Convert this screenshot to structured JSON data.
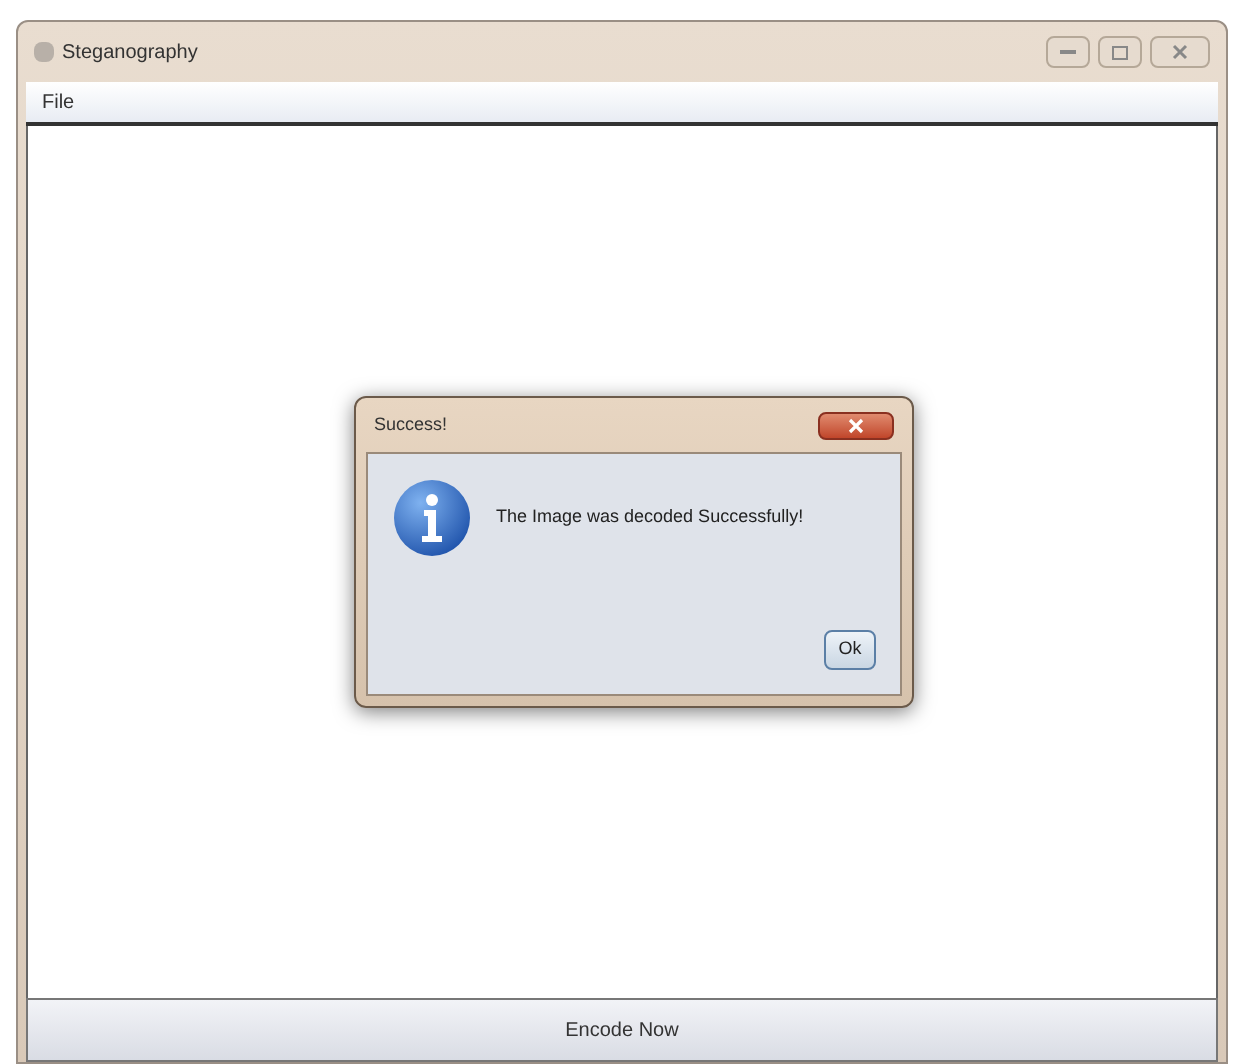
{
  "window": {
    "title": "Steganography"
  },
  "menu_bar": {
    "items": [
      "File"
    ]
  },
  "dialog": {
    "title": "Success!",
    "message": "The Image was decoded Successfully!",
    "buttons": [
      "Ok"
    ]
  },
  "bottom_button": {
    "label": "Encode Now"
  }
}
